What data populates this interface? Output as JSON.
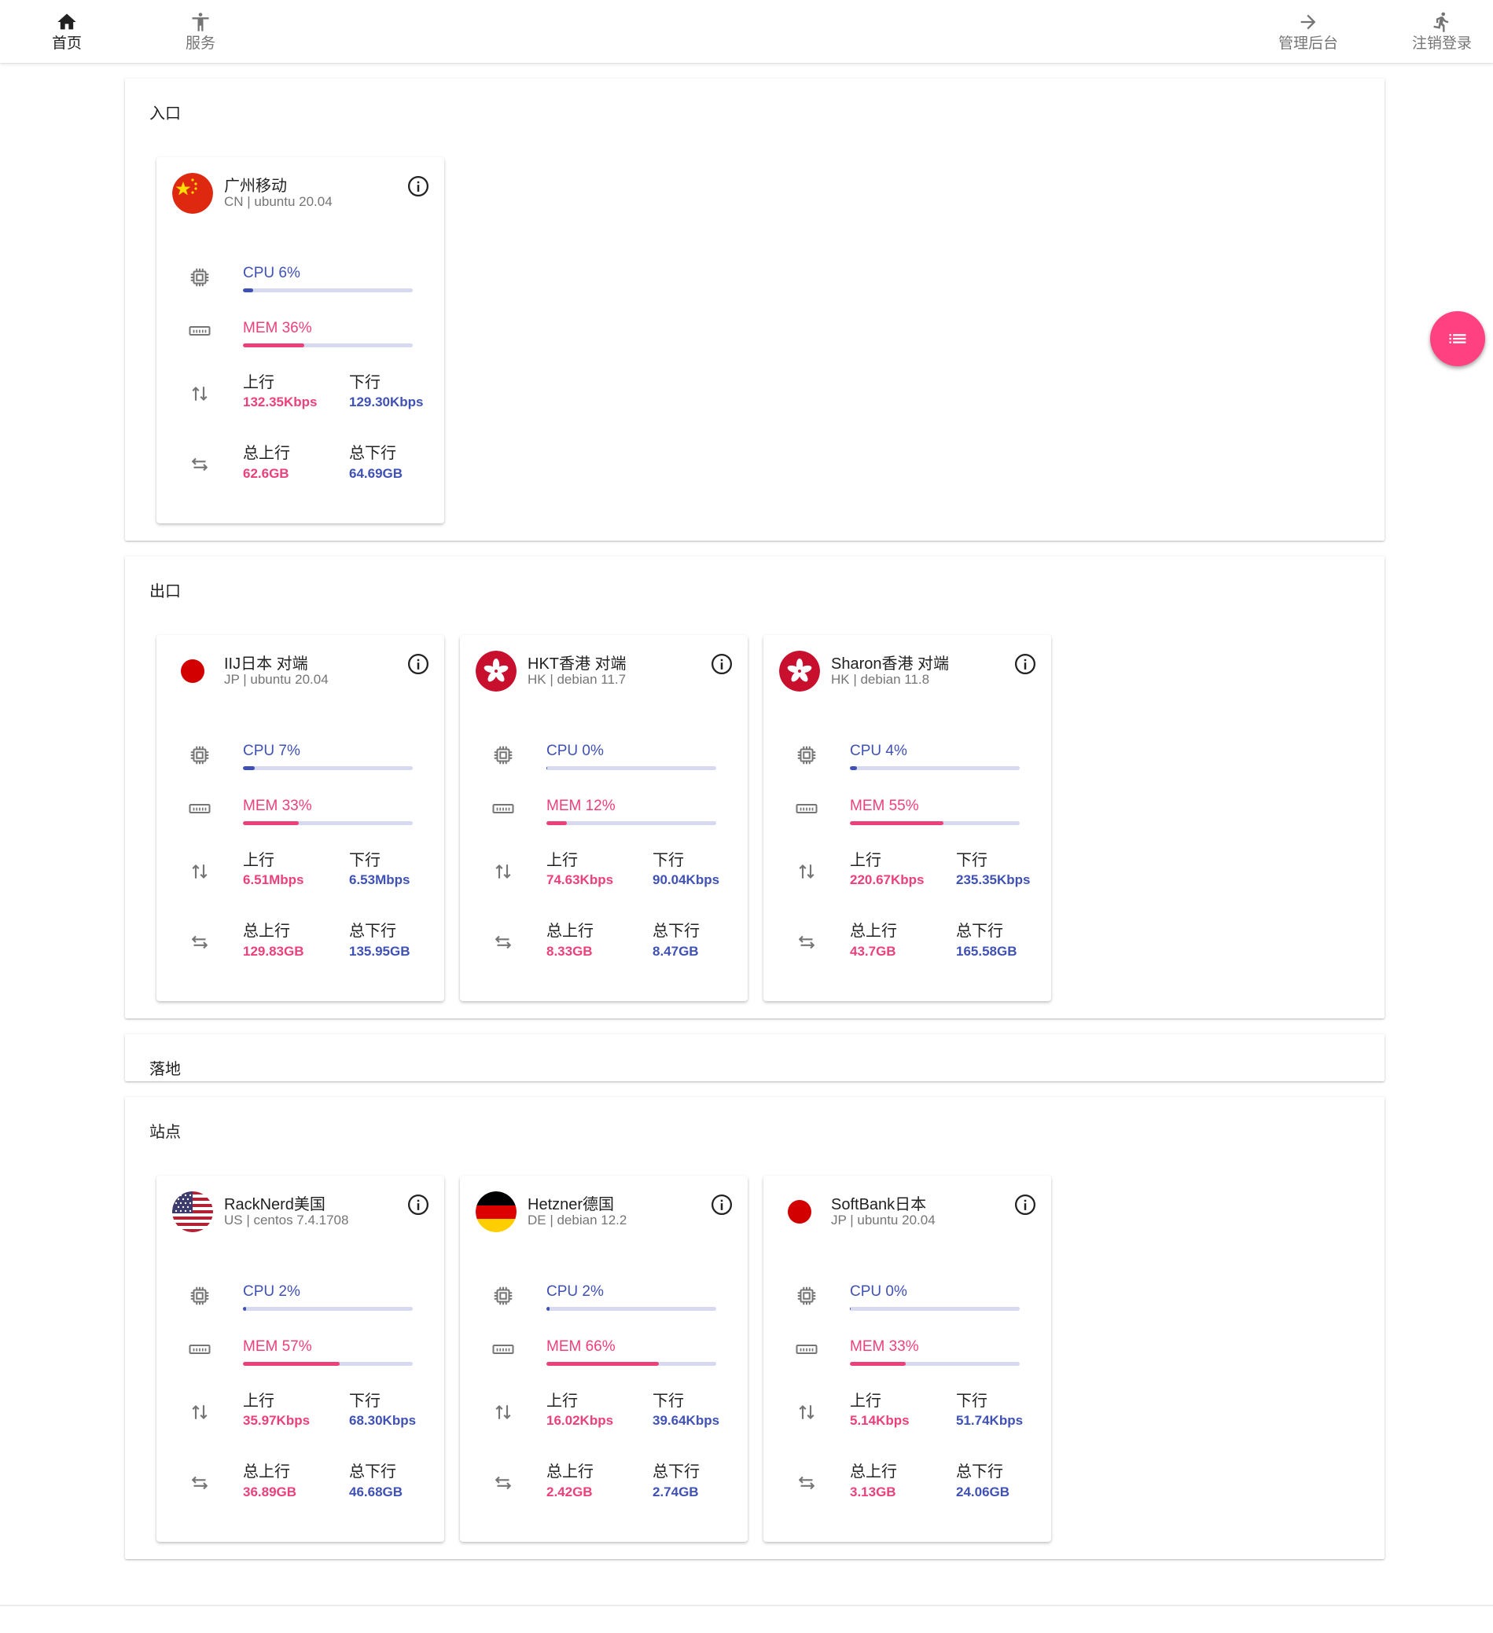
{
  "nav": {
    "left": [
      {
        "label": "首页",
        "icon": "home-icon",
        "active": true
      },
      {
        "label": "服务",
        "icon": "accessibility-icon",
        "active": false
      }
    ],
    "right": [
      {
        "label": "管理后台",
        "icon": "arrow-right-icon"
      },
      {
        "label": "注销登录",
        "icon": "run-icon"
      }
    ]
  },
  "colors": {
    "accent_blue": "#3f51b5",
    "accent_pink": "#ec407a",
    "fab": "#ff4081"
  },
  "labels": {
    "up": "上行",
    "down": "下行",
    "total_up": "总上行",
    "total_down": "总下行"
  },
  "sections": [
    {
      "title": "入口",
      "cards": [
        {
          "name": "广州移动",
          "sub": "CN | ubuntu 20.04",
          "flag": "cn",
          "cpu_label": "CPU 6%",
          "cpu": 6,
          "mem_label": "MEM 36%",
          "mem": 36,
          "up": "132.35Kbps",
          "down": "129.30Kbps",
          "total_up": "62.6GB",
          "total_down": "64.69GB"
        }
      ]
    },
    {
      "title": "出口",
      "cards": [
        {
          "name": "IIJ日本 对端",
          "sub": "JP | ubuntu 20.04",
          "flag": "jp",
          "cpu_label": "CPU 7%",
          "cpu": 7,
          "mem_label": "MEM 33%",
          "mem": 33,
          "up": "6.51Mbps",
          "down": "6.53Mbps",
          "total_up": "129.83GB",
          "total_down": "135.95GB"
        },
        {
          "name": "HKT香港 对端",
          "sub": "HK | debian 11.7",
          "flag": "hk",
          "cpu_label": "CPU 0%",
          "cpu": 0,
          "mem_label": "MEM 12%",
          "mem": 12,
          "up": "74.63Kbps",
          "down": "90.04Kbps",
          "total_up": "8.33GB",
          "total_down": "8.47GB"
        },
        {
          "name": "Sharon香港 对端",
          "sub": "HK | debian 11.8",
          "flag": "hk",
          "cpu_label": "CPU 4%",
          "cpu": 4,
          "mem_label": "MEM 55%",
          "mem": 55,
          "up": "220.67Kbps",
          "down": "235.35Kbps",
          "total_up": "43.7GB",
          "total_down": "165.58GB"
        }
      ]
    },
    {
      "title": "落地",
      "cards": []
    },
    {
      "title": "站点",
      "cards": [
        {
          "name": "RackNerd美国",
          "sub": "US | centos 7.4.1708",
          "flag": "us",
          "cpu_label": "CPU 2%",
          "cpu": 2,
          "mem_label": "MEM 57%",
          "mem": 57,
          "up": "35.97Kbps",
          "down": "68.30Kbps",
          "total_up": "36.89GB",
          "total_down": "46.68GB"
        },
        {
          "name": "Hetzner德国",
          "sub": "DE | debian 12.2",
          "flag": "de",
          "cpu_label": "CPU 2%",
          "cpu": 2,
          "mem_label": "MEM 66%",
          "mem": 66,
          "up": "16.02Kbps",
          "down": "39.64Kbps",
          "total_up": "2.42GB",
          "total_down": "2.74GB"
        },
        {
          "name": "SoftBank日本",
          "sub": "JP | ubuntu 20.04",
          "flag": "jp",
          "cpu_label": "CPU 0%",
          "cpu": 0,
          "mem_label": "MEM 33%",
          "mem": 33,
          "up": "5.14Kbps",
          "down": "51.74Kbps",
          "total_up": "3.13GB",
          "total_down": "24.06GB"
        }
      ]
    }
  ],
  "fab": {
    "icon": "list-icon"
  }
}
